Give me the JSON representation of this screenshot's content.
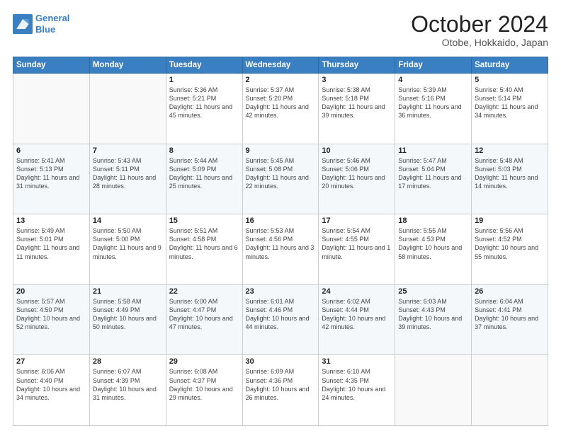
{
  "header": {
    "logo_line1": "General",
    "logo_line2": "Blue",
    "month": "October 2024",
    "location": "Otobe, Hokkaido, Japan"
  },
  "weekdays": [
    "Sunday",
    "Monday",
    "Tuesday",
    "Wednesday",
    "Thursday",
    "Friday",
    "Saturday"
  ],
  "weeks": [
    [
      {
        "day": "",
        "sunrise": "",
        "sunset": "",
        "daylight": ""
      },
      {
        "day": "",
        "sunrise": "",
        "sunset": "",
        "daylight": ""
      },
      {
        "day": "1",
        "sunrise": "Sunrise: 5:36 AM",
        "sunset": "Sunset: 5:21 PM",
        "daylight": "Daylight: 11 hours and 45 minutes."
      },
      {
        "day": "2",
        "sunrise": "Sunrise: 5:37 AM",
        "sunset": "Sunset: 5:20 PM",
        "daylight": "Daylight: 11 hours and 42 minutes."
      },
      {
        "day": "3",
        "sunrise": "Sunrise: 5:38 AM",
        "sunset": "Sunset: 5:18 PM",
        "daylight": "Daylight: 11 hours and 39 minutes."
      },
      {
        "day": "4",
        "sunrise": "Sunrise: 5:39 AM",
        "sunset": "Sunset: 5:16 PM",
        "daylight": "Daylight: 11 hours and 36 minutes."
      },
      {
        "day": "5",
        "sunrise": "Sunrise: 5:40 AM",
        "sunset": "Sunset: 5:14 PM",
        "daylight": "Daylight: 11 hours and 34 minutes."
      }
    ],
    [
      {
        "day": "6",
        "sunrise": "Sunrise: 5:41 AM",
        "sunset": "Sunset: 5:13 PM",
        "daylight": "Daylight: 11 hours and 31 minutes."
      },
      {
        "day": "7",
        "sunrise": "Sunrise: 5:43 AM",
        "sunset": "Sunset: 5:11 PM",
        "daylight": "Daylight: 11 hours and 28 minutes."
      },
      {
        "day": "8",
        "sunrise": "Sunrise: 5:44 AM",
        "sunset": "Sunset: 5:09 PM",
        "daylight": "Daylight: 11 hours and 25 minutes."
      },
      {
        "day": "9",
        "sunrise": "Sunrise: 5:45 AM",
        "sunset": "Sunset: 5:08 PM",
        "daylight": "Daylight: 11 hours and 22 minutes."
      },
      {
        "day": "10",
        "sunrise": "Sunrise: 5:46 AM",
        "sunset": "Sunset: 5:06 PM",
        "daylight": "Daylight: 11 hours and 20 minutes."
      },
      {
        "day": "11",
        "sunrise": "Sunrise: 5:47 AM",
        "sunset": "Sunset: 5:04 PM",
        "daylight": "Daylight: 11 hours and 17 minutes."
      },
      {
        "day": "12",
        "sunrise": "Sunrise: 5:48 AM",
        "sunset": "Sunset: 5:03 PM",
        "daylight": "Daylight: 11 hours and 14 minutes."
      }
    ],
    [
      {
        "day": "13",
        "sunrise": "Sunrise: 5:49 AM",
        "sunset": "Sunset: 5:01 PM",
        "daylight": "Daylight: 11 hours and 11 minutes."
      },
      {
        "day": "14",
        "sunrise": "Sunrise: 5:50 AM",
        "sunset": "Sunset: 5:00 PM",
        "daylight": "Daylight: 11 hours and 9 minutes."
      },
      {
        "day": "15",
        "sunrise": "Sunrise: 5:51 AM",
        "sunset": "Sunset: 4:58 PM",
        "daylight": "Daylight: 11 hours and 6 minutes."
      },
      {
        "day": "16",
        "sunrise": "Sunrise: 5:53 AM",
        "sunset": "Sunset: 4:56 PM",
        "daylight": "Daylight: 11 hours and 3 minutes."
      },
      {
        "day": "17",
        "sunrise": "Sunrise: 5:54 AM",
        "sunset": "Sunset: 4:55 PM",
        "daylight": "Daylight: 11 hours and 1 minute."
      },
      {
        "day": "18",
        "sunrise": "Sunrise: 5:55 AM",
        "sunset": "Sunset: 4:53 PM",
        "daylight": "Daylight: 10 hours and 58 minutes."
      },
      {
        "day": "19",
        "sunrise": "Sunrise: 5:56 AM",
        "sunset": "Sunset: 4:52 PM",
        "daylight": "Daylight: 10 hours and 55 minutes."
      }
    ],
    [
      {
        "day": "20",
        "sunrise": "Sunrise: 5:57 AM",
        "sunset": "Sunset: 4:50 PM",
        "daylight": "Daylight: 10 hours and 52 minutes."
      },
      {
        "day": "21",
        "sunrise": "Sunrise: 5:58 AM",
        "sunset": "Sunset: 4:49 PM",
        "daylight": "Daylight: 10 hours and 50 minutes."
      },
      {
        "day": "22",
        "sunrise": "Sunrise: 6:00 AM",
        "sunset": "Sunset: 4:47 PM",
        "daylight": "Daylight: 10 hours and 47 minutes."
      },
      {
        "day": "23",
        "sunrise": "Sunrise: 6:01 AM",
        "sunset": "Sunset: 4:46 PM",
        "daylight": "Daylight: 10 hours and 44 minutes."
      },
      {
        "day": "24",
        "sunrise": "Sunrise: 6:02 AM",
        "sunset": "Sunset: 4:44 PM",
        "daylight": "Daylight: 10 hours and 42 minutes."
      },
      {
        "day": "25",
        "sunrise": "Sunrise: 6:03 AM",
        "sunset": "Sunset: 4:43 PM",
        "daylight": "Daylight: 10 hours and 39 minutes."
      },
      {
        "day": "26",
        "sunrise": "Sunrise: 6:04 AM",
        "sunset": "Sunset: 4:41 PM",
        "daylight": "Daylight: 10 hours and 37 minutes."
      }
    ],
    [
      {
        "day": "27",
        "sunrise": "Sunrise: 6:06 AM",
        "sunset": "Sunset: 4:40 PM",
        "daylight": "Daylight: 10 hours and 34 minutes."
      },
      {
        "day": "28",
        "sunrise": "Sunrise: 6:07 AM",
        "sunset": "Sunset: 4:39 PM",
        "daylight": "Daylight: 10 hours and 31 minutes."
      },
      {
        "day": "29",
        "sunrise": "Sunrise: 6:08 AM",
        "sunset": "Sunset: 4:37 PM",
        "daylight": "Daylight: 10 hours and 29 minutes."
      },
      {
        "day": "30",
        "sunrise": "Sunrise: 6:09 AM",
        "sunset": "Sunset: 4:36 PM",
        "daylight": "Daylight: 10 hours and 26 minutes."
      },
      {
        "day": "31",
        "sunrise": "Sunrise: 6:10 AM",
        "sunset": "Sunset: 4:35 PM",
        "daylight": "Daylight: 10 hours and 24 minutes."
      },
      {
        "day": "",
        "sunrise": "",
        "sunset": "",
        "daylight": ""
      },
      {
        "day": "",
        "sunrise": "",
        "sunset": "",
        "daylight": ""
      }
    ]
  ]
}
